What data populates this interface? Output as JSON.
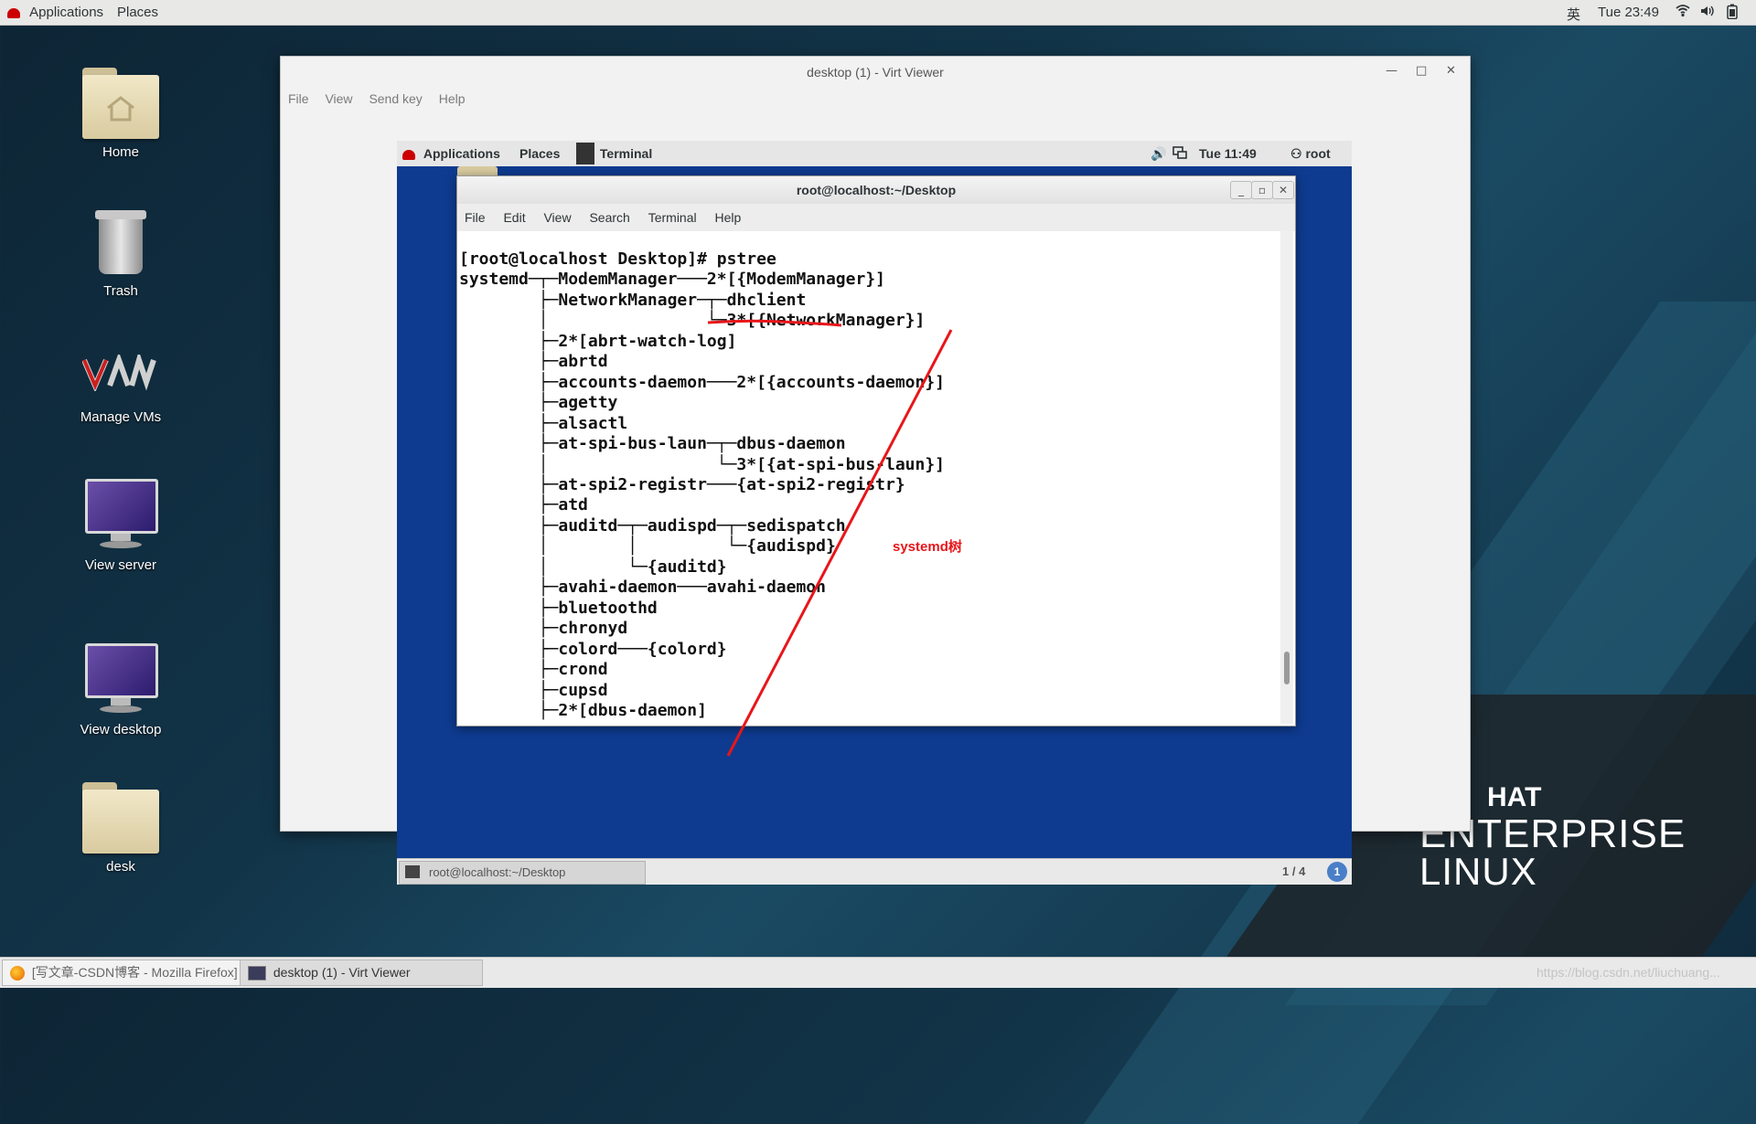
{
  "host_panel": {
    "applications": "Applications",
    "places": "Places",
    "ime": "英",
    "clock": "Tue 23:49"
  },
  "desktop_icons": [
    {
      "label": "Home"
    },
    {
      "label": "Trash"
    },
    {
      "label": "Manage VMs"
    },
    {
      "label": "View server"
    },
    {
      "label": "View desktop"
    },
    {
      "label": "desk"
    }
  ],
  "brand": {
    "line1": "HAT",
    "line2": "ENTERPRISE",
    "line3": "LINUX"
  },
  "virt_viewer": {
    "title": "desktop (1) - Virt Viewer",
    "menu": [
      "File",
      "View",
      "Send key",
      "Help"
    ],
    "guest_panel": {
      "applications": "Applications",
      "places": "Places",
      "terminal": "Terminal",
      "clock": "Tue 11:49",
      "user": "root"
    },
    "terminal": {
      "title": "root@localhost:~/Desktop",
      "menu": [
        "File",
        "Edit",
        "View",
        "Search",
        "Terminal",
        "Help"
      ],
      "lines": [
        "[root@localhost Desktop]# pstree",
        "systemd─┬─ModemManager───2*[{ModemManager}]",
        "        ├─NetworkManager─┬─dhclient",
        "        │                └─3*[{NetworkManager}]",
        "        ├─2*[abrt-watch-log]",
        "        ├─abrtd",
        "        ├─accounts-daemon───2*[{accounts-daemon}]",
        "        ├─agetty",
        "        ├─alsactl",
        "        ├─at-spi-bus-laun─┬─dbus-daemon",
        "        │                 └─3*[{at-spi-bus-laun}]",
        "        ├─at-spi2-registr───{at-spi2-registr}",
        "        ├─atd",
        "        ├─auditd─┬─audispd─┬─sedispatch",
        "        │        │         └─{audispd}",
        "        │        └─{auditd}",
        "        ├─avahi-daemon───avahi-daemon",
        "        ├─bluetoothd",
        "        ├─chronyd",
        "        ├─colord───{colord}",
        "        ├─crond",
        "        ├─cupsd",
        "        ├─2*[dbus-daemon]"
      ]
    },
    "annotation": "systemd树",
    "guest_taskbar": {
      "window": "root@localhost:~/Desktop",
      "workspace": "1 / 4"
    }
  },
  "host_taskbar": {
    "items": [
      "[写文章-CSDN博客 - Mozilla Firefox]",
      "desktop (1) - Virt Viewer"
    ],
    "watermark": "https://blog.csdn.net/liuchuang..."
  },
  "colors": {
    "annotation_red": "#e8161a",
    "guest_bg": "#0e3b8f"
  }
}
